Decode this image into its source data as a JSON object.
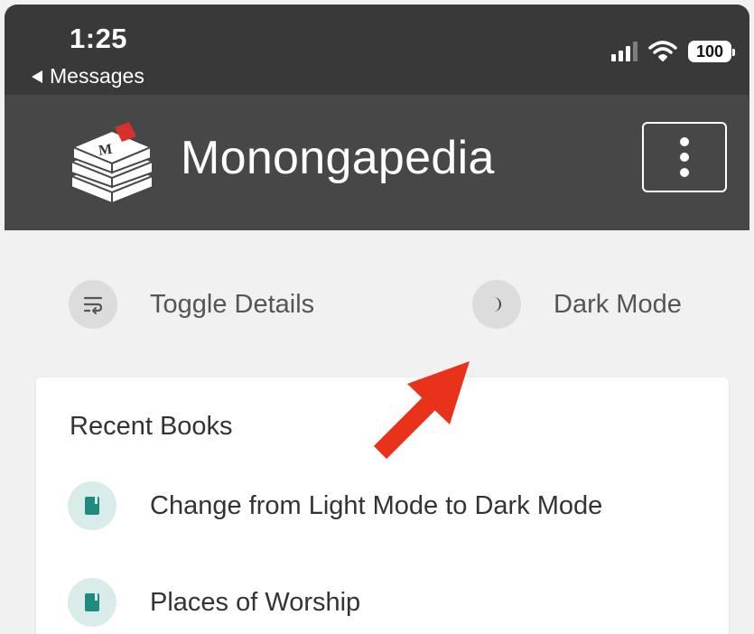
{
  "status_bar": {
    "time": "1:25",
    "back_label": "Messages",
    "battery": "100",
    "icons": [
      "signal-icon",
      "wifi-icon",
      "battery-icon"
    ]
  },
  "header": {
    "title": "Monongapedia",
    "logo_icon": "stacked-books-logo",
    "menu_icon": "kebab-menu-icon"
  },
  "toolbar": {
    "toggle_details_label": "Toggle Details",
    "dark_mode_label": "Dark Mode",
    "toggle_icon": "wrap-text-icon",
    "dark_mode_icon": "moon-icon"
  },
  "recent_books": {
    "heading": "Recent Books",
    "items": [
      {
        "label": "Change from Light Mode to Dark Mode",
        "icon": "book-icon"
      },
      {
        "label": "Places of Worship",
        "icon": "book-icon"
      }
    ]
  },
  "colors": {
    "status_bar_bg": "#393939",
    "header_bg": "#474747",
    "page_bg": "#f1f1f1",
    "book_icon_bg": "#d9ecea",
    "book_icon_fg": "#1f8a7f",
    "annotation_arrow": "#e8321a"
  }
}
